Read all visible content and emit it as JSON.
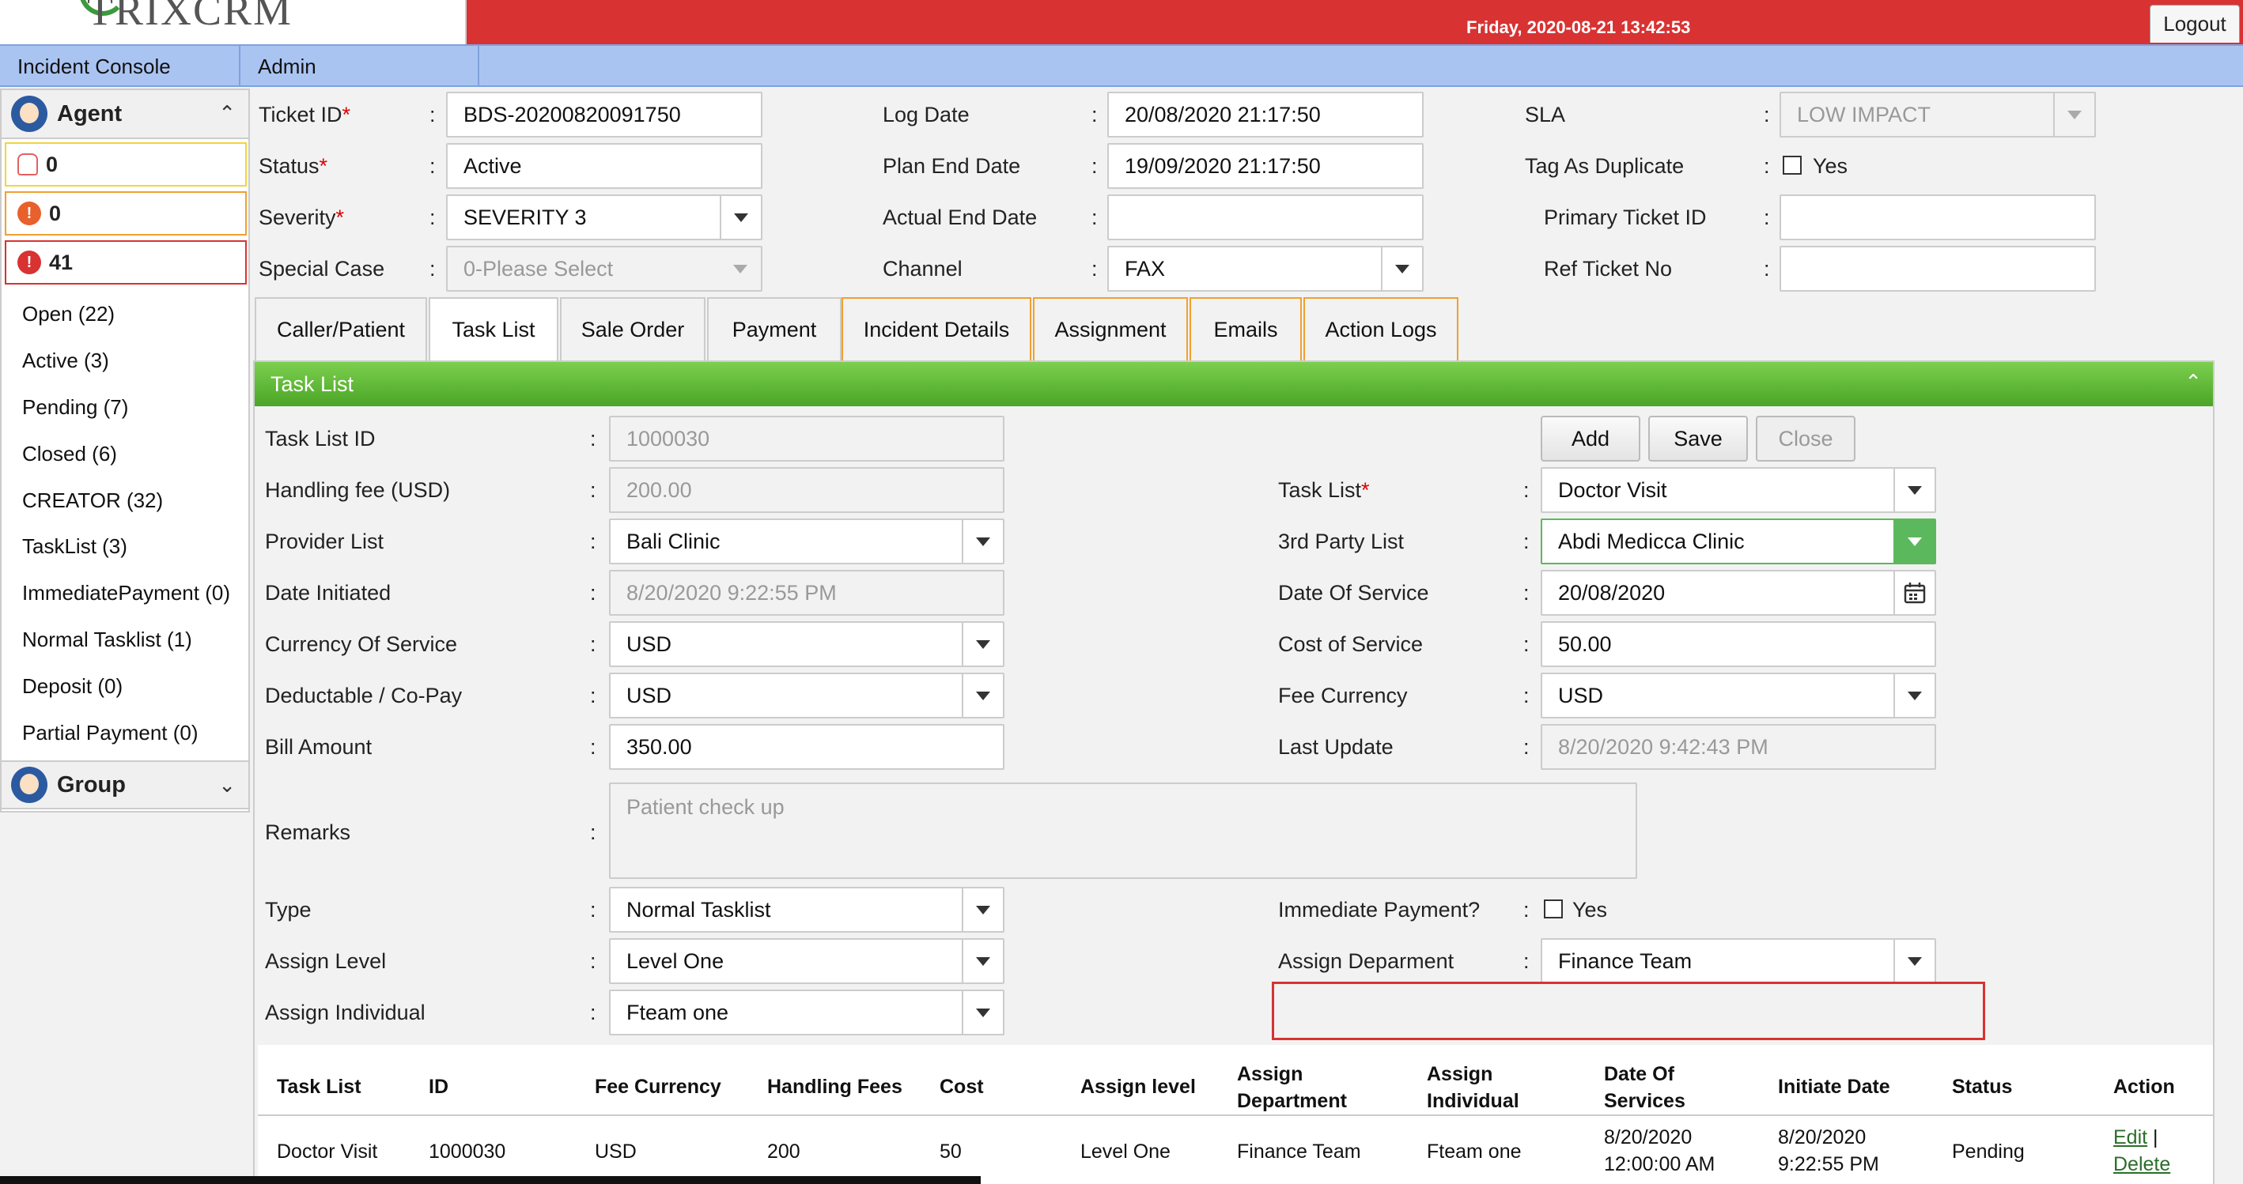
{
  "app": {
    "logo": "TRIXCRM",
    "datetime": "Friday, 2020-08-21 13:42:53",
    "logout": "Logout"
  },
  "menu": [
    "Incident Console",
    "Admin"
  ],
  "sidebar": {
    "agent_title": "Agent",
    "group_title": "Group",
    "counters": [
      "0",
      "0",
      "41"
    ],
    "links": [
      "Open (22)",
      "Active (3)",
      "Pending (7)",
      "Closed (6)",
      "CREATOR (32)",
      "TaskList (3)",
      "ImmediatePayment (0)",
      "Normal Tasklist (1)",
      "Deposit (0)",
      "Partial Payment (0)"
    ]
  },
  "ticket": {
    "ticket_id_label": "Ticket ID",
    "ticket_id": "BDS-20200820091750",
    "status_label": "Status",
    "status": "Active",
    "severity_label": "Severity",
    "severity": "SEVERITY 3",
    "special_case_label": "Special Case",
    "special_case": "0-Please Select",
    "log_date_label": "Log Date",
    "log_date": "20/08/2020 21:17:50",
    "plan_end_label": "Plan End Date",
    "plan_end": "19/09/2020 21:17:50",
    "actual_end_label": "Actual End Date",
    "actual_end": "",
    "channel_label": "Channel",
    "channel": "FAX",
    "sla_label": "SLA",
    "sla": "LOW IMPACT",
    "tag_dup_label": "Tag As Duplicate",
    "tag_dup_yes": "Yes",
    "primary_label": "Primary Ticket ID",
    "primary": "",
    "ref_label": "Ref Ticket No",
    "ref": ""
  },
  "tabs": [
    "Caller/Patient",
    "Task List",
    "Sale Order",
    "Payment",
    "Incident Details",
    "Assignment",
    "Emails",
    "Action Logs"
  ],
  "panel": {
    "title": "Task List",
    "buttons": {
      "add": "Add",
      "save": "Save",
      "close": "Close"
    },
    "left": {
      "task_list_id_label": "Task List ID",
      "task_list_id": "1000030",
      "handling_fee_label": "Handling fee (USD)",
      "handling_fee": "200.00",
      "provider_label": "Provider List",
      "provider": "Bali Clinic",
      "date_init_label": "Date Initiated",
      "date_init": "8/20/2020 9:22:55 PM",
      "currency_label": "Currency Of Service",
      "currency": "USD",
      "deductable_label": "Deductable / Co-Pay",
      "deductable": "USD",
      "bill_label": "Bill Amount",
      "bill": "350.00",
      "remarks_label": "Remarks",
      "remarks": "Patient check up",
      "type_label": "Type",
      "type": "Normal Tasklist",
      "assign_level_label": "Assign Level",
      "assign_level": "Level One",
      "assign_ind_label": "Assign Individual",
      "assign_ind": "Fteam one"
    },
    "right": {
      "task_list_label": "Task List",
      "task_list": "Doctor Visit",
      "third_party_label": "3rd Party List",
      "third_party": "Abdi Medicca Clinic",
      "date_service_label": "Date Of Service",
      "date_service": "20/08/2020",
      "cost_label": "Cost of Service",
      "cost": "50.00",
      "fee_currency_label": "Fee Currency",
      "fee_currency": "USD",
      "last_update_label": "Last Update",
      "last_update": "8/20/2020 9:42:43 PM",
      "immediate_label": "Immediate Payment?",
      "immediate_yes": "Yes",
      "assign_dept_label": "Assign Deparment",
      "assign_dept": "Finance Team"
    }
  },
  "table": {
    "headers": [
      "Task List",
      "ID",
      "Fee Currency",
      "Handling Fees",
      "Cost",
      "Assign level",
      "Assign\nDepartment",
      "Assign\nIndividual",
      "Date Of\nServices",
      "Initiate Date",
      "Status",
      "Action"
    ],
    "row": {
      "task_list": "Doctor Visit",
      "id": "1000030",
      "fee_currency": "USD",
      "handling": "200",
      "cost": "50",
      "level": "Level One",
      "dept": "Finance Team",
      "individual": "Fteam one",
      "date_service_1": "8/20/2020",
      "date_service_2": "12:00:00 AM",
      "initiate_1": "8/20/2020",
      "initiate_2": "9:22:55 PM",
      "status": "Pending",
      "edit": "Edit",
      "sep": "|",
      "delete": "Delete"
    }
  },
  "colors": {
    "header_red": "#d83232",
    "menu_blue": "#aac4f2",
    "panel_green": "#5cb85c",
    "tab_orange": "#f0a030"
  }
}
